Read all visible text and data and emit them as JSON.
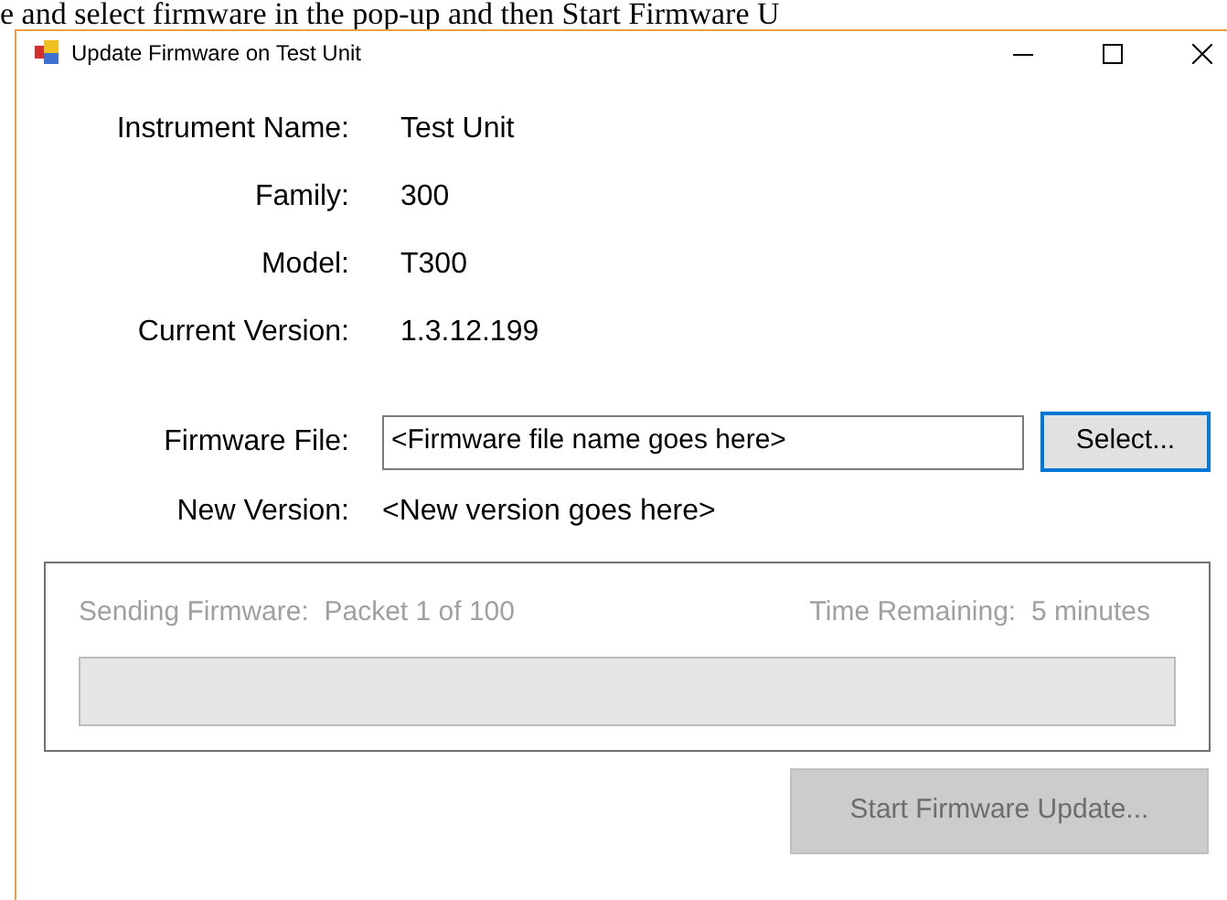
{
  "background_text": "e and select firmware in the pop-up and then Start Firmware U",
  "window": {
    "title": "Update Firmware on Test Unit"
  },
  "info": [
    {
      "label": "Instrument Name:",
      "value": "Test Unit"
    },
    {
      "label": "Family:",
      "value": "300"
    },
    {
      "label": "Model:",
      "value": "T300"
    },
    {
      "label": "Current Version:",
      "value": "1.3.12.199"
    }
  ],
  "firmware_file": {
    "label": "Firmware File:",
    "value": "<Firmware file name goes here>",
    "button": "Select..."
  },
  "new_version": {
    "label": "New Version:",
    "value": "<New version goes here>"
  },
  "progress": {
    "disabled": true,
    "sending_label": "Sending Firmware:",
    "sending_value": "Packet 1 of 100",
    "time_label": "Time Remaining:",
    "time_value": "5 minutes",
    "level": 0
  },
  "start_button": {
    "label": "Start Firmware Update...",
    "disabled": true
  }
}
